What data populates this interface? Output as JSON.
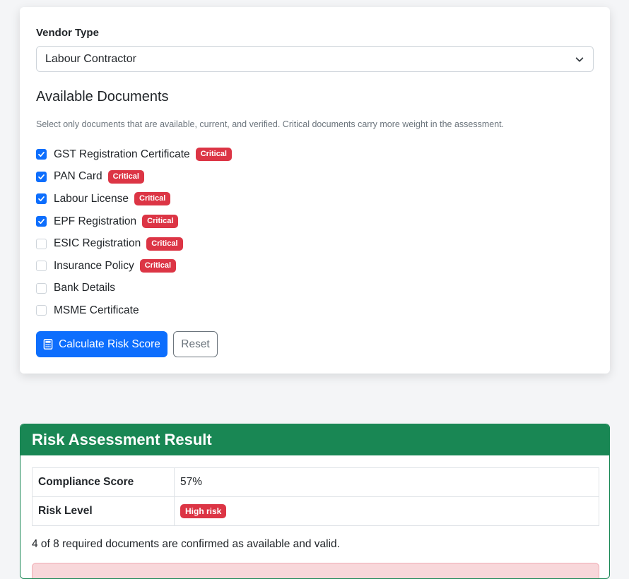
{
  "form": {
    "vendor_type_label": "Vendor Type",
    "vendor_type_value": "Labour Contractor",
    "documents_heading": "Available Documents",
    "help_text": "Select only documents that are available, current, and verified. Critical documents carry more weight in the assessment.",
    "documents": [
      {
        "label": "GST Registration Certificate",
        "checked": true,
        "critical": true
      },
      {
        "label": "PAN Card",
        "checked": true,
        "critical": true
      },
      {
        "label": "Labour License",
        "checked": true,
        "critical": true
      },
      {
        "label": "EPF Registration",
        "checked": true,
        "critical": true
      },
      {
        "label": "ESIC Registration",
        "checked": false,
        "critical": true
      },
      {
        "label": "Insurance Policy",
        "checked": false,
        "critical": true
      },
      {
        "label": "Bank Details",
        "checked": false,
        "critical": false
      },
      {
        "label": "MSME Certificate",
        "checked": false,
        "critical": false
      }
    ],
    "critical_badge": "Critical",
    "calculate_label": "Calculate Risk Score",
    "reset_label": "Reset"
  },
  "result": {
    "title": "Risk Assessment Result",
    "compliance_score_label": "Compliance Score",
    "compliance_score_value": "57%",
    "risk_level_label": "Risk Level",
    "risk_level_value": "High risk",
    "summary": "4 of 8 required documents are confirmed as available and valid."
  },
  "colors": {
    "primary": "#0d6efd",
    "danger": "#dc3545",
    "success": "#198754"
  },
  "icons": {
    "select_caret": "chevron-down-icon",
    "calculate": "calculator-icon",
    "checkbox_checked": "check-icon"
  }
}
